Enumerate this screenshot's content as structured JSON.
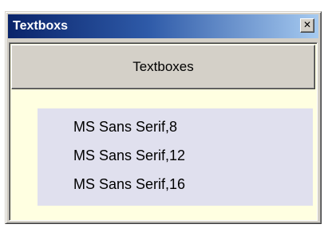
{
  "window": {
    "title": "Textboxs",
    "close_glyph": "✕",
    "close_icon": "close-icon"
  },
  "header": {
    "label": "Textboxes"
  },
  "textboxes": [
    {
      "text": "MS Sans Serif,8"
    },
    {
      "text": "MS Sans Serif,12"
    },
    {
      "text": "MS Sans Serif,16"
    }
  ],
  "colors": {
    "titlebar_start": "#0a246a",
    "titlebar_end": "#a6caf0",
    "client_background": "#ffffe1",
    "list_background": "#e0e0ee",
    "button_face": "#d4d0c8"
  }
}
